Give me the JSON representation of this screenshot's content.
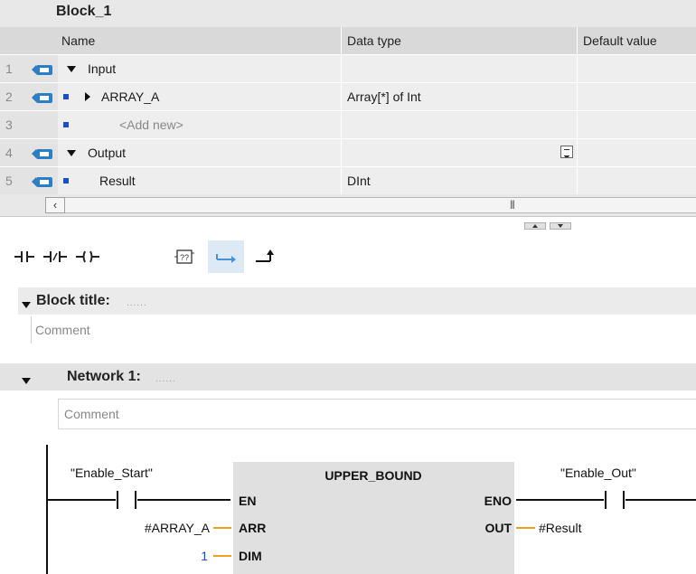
{
  "block": {
    "name": "Block_1"
  },
  "interface": {
    "columns": {
      "name": "Name",
      "data_type": "Data type",
      "default_value": "Default value"
    },
    "rows": [
      {
        "num": "1",
        "name": "Input",
        "data_type": "",
        "default_value": ""
      },
      {
        "num": "2",
        "name": "ARRAY_A",
        "data_type": "Array[*] of Int",
        "default_value": ""
      },
      {
        "num": "3",
        "name": "<Add new>",
        "data_type": "",
        "default_value": ""
      },
      {
        "num": "4",
        "name": "Output",
        "data_type": "",
        "default_value": ""
      },
      {
        "num": "5",
        "name": "Result",
        "data_type": "DInt",
        "default_value": ""
      }
    ]
  },
  "toolbar": {
    "icons": [
      "normally-open-contact-icon",
      "normally-closed-contact-icon",
      "coil-icon",
      "empty-box-icon",
      "open-branch-icon",
      "close-branch-icon"
    ],
    "active_index": 4
  },
  "block_title": {
    "label": "Block title:",
    "dots": "......",
    "comment": "Comment"
  },
  "network": {
    "label": "Network 1:",
    "dots": "......",
    "comment": "Comment",
    "input_contact_tag": "\"Enable_Start\"",
    "output_contact_tag": "\"Enable_Out\"",
    "box": {
      "title": "UPPER_BOUND",
      "pin_en": "EN",
      "pin_arr": "ARR",
      "pin_dim": "DIM",
      "pin_eno": "ENO",
      "pin_out": "OUT"
    },
    "arr_operand": "#ARRAY_A",
    "dim_operand": "1",
    "out_operand": "#Result"
  },
  "colors": {
    "accent_blue": "#1b4fc7",
    "wire_orange": "#f0a020",
    "box_grey": "#e0e0e0"
  }
}
